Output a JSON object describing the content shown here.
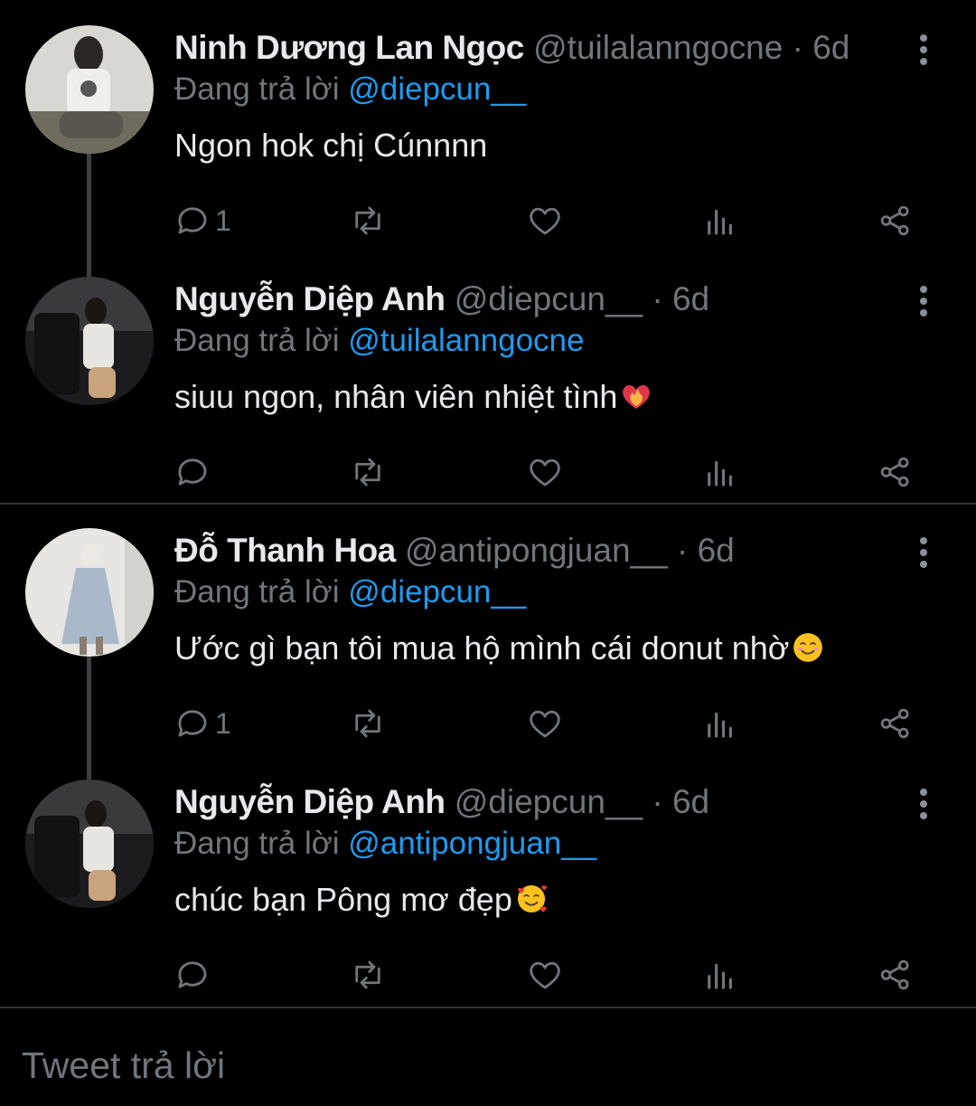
{
  "tweets": [
    {
      "name": "Ninh Dương Lan Ngọc",
      "handle": "@tuilalanngocne",
      "time": "6d",
      "reply_prefix": "Đang trả lời ",
      "reply_to": "@diepcun__",
      "text": "Ngon hok chị Cúnnnn",
      "reply_count": "1",
      "emoji": ""
    },
    {
      "name": "Nguyễn Diệp Anh",
      "handle": "@diepcun__",
      "time": "6d",
      "reply_prefix": "Đang trả lời ",
      "reply_to": "@tuilalanngocne",
      "text": "siuu ngon, nhân viên nhiệt tình",
      "reply_count": "",
      "emoji": "heart-on-fire"
    },
    {
      "name": "Đỗ Thanh Hoa",
      "handle": "@antipongjuan__",
      "time": "6d",
      "reply_prefix": "Đang trả lời ",
      "reply_to": "@diepcun__",
      "text": "Ước gì bạn tôi mua hộ mình cái donut nhờ",
      "reply_count": "1",
      "emoji": "smiling-face"
    },
    {
      "name": "Nguyễn Diệp Anh",
      "handle": "@diepcun__",
      "time": "6d",
      "reply_prefix": "Đang trả lời ",
      "reply_to": "@antipongjuan__",
      "text": "chúc bạn Pông mơ đẹp",
      "reply_count": "",
      "emoji": "smiling-face-with-hearts"
    }
  ],
  "separator": "·",
  "reply_box": {
    "placeholder": "Tweet trả lời"
  },
  "colors": {
    "background": "#000000",
    "text": "#e7e9ea",
    "muted": "#71767b",
    "link": "#1d9bf0",
    "line": "#2f3336"
  }
}
